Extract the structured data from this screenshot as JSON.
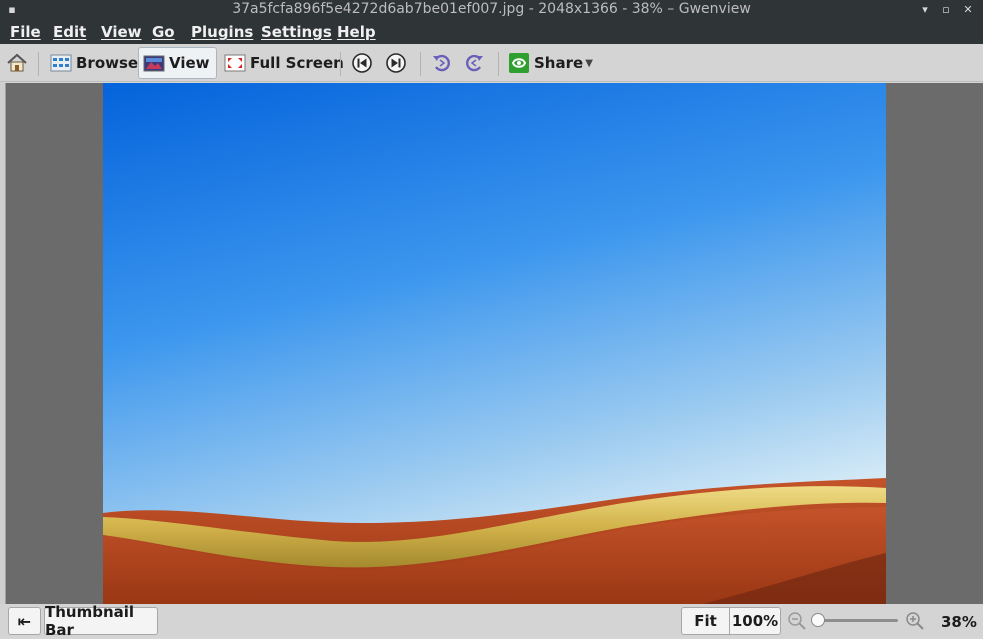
{
  "window": {
    "title": "37a5fcfa896f5e4272d6ab7be01ef007.jpg - 2048x1366 - 38% – Gwenview",
    "controls": [
      "minimize-icon",
      "maximize-icon",
      "close-icon"
    ]
  },
  "menu": {
    "file": "File",
    "edit": "Edit",
    "view": "View",
    "go": "Go",
    "plugins": "Plugins",
    "settings": "Settings",
    "help": "Help"
  },
  "toolbar": {
    "home_icon": "home-icon",
    "browse_label": "Browse",
    "view_label": "View",
    "fullscreen_label": "Full Screen",
    "previous_icon": "previous-icon",
    "next_icon": "next-icon",
    "rotate_left_icon": "rotate-left-icon",
    "rotate_right_icon": "rotate-right-icon",
    "share_label": "Share",
    "active_tab": "View"
  },
  "statusbar": {
    "thumbnail_bar_label": "Thumbnail Bar",
    "fit_label": "Fit",
    "hundred_label": "100%",
    "zoom_value": "38%",
    "zoom_fraction": 0.05
  },
  "colors": {
    "titlebar_bg": "#2f3437",
    "toolbar_bg": "#d4d4d4",
    "viewport_bg": "#6b6b6b",
    "sky_top": "#0a74e4",
    "sky_bottom": "#cfe6f5",
    "field_gold": "#d9c15a",
    "field_red": "#b64a1f"
  }
}
